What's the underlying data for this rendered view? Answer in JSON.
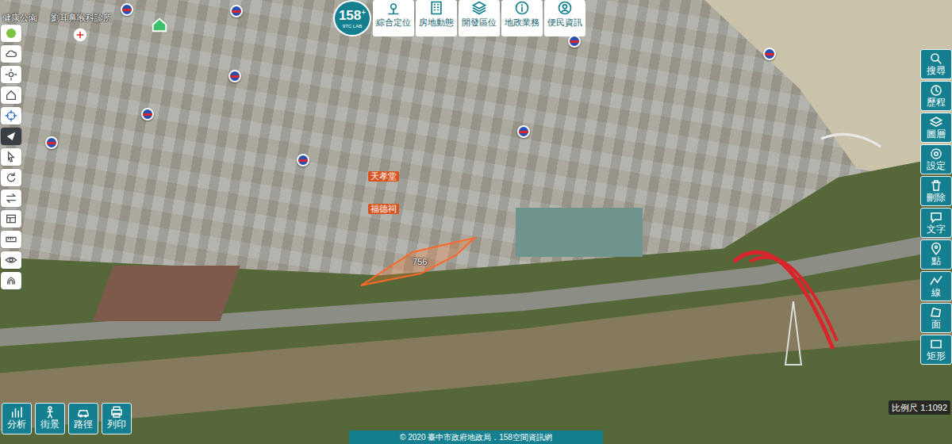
{
  "logo": {
    "number": "158",
    "mark": "+",
    "subtitle": "9TC LAB"
  },
  "top_menu": [
    "綜合定位",
    "房地動態",
    "開發區位",
    "地政業務",
    "便民資訊"
  ],
  "right_tools": [
    "搜尋",
    "歷程",
    "圖層",
    "設定",
    "刪除",
    "文字",
    "點",
    "線",
    "面",
    "矩形"
  ],
  "bottom_tools": [
    "分析",
    "街景",
    "路徑",
    "列印"
  ],
  "map_labels": [
    {
      "text": "健康公園",
      "kind": "poi"
    },
    {
      "text": "劉耳鼻喉科診所",
      "kind": "poi"
    },
    {
      "text": "天孝堂",
      "kind": "temple"
    },
    {
      "text": "福德祠",
      "kind": "temple"
    },
    {
      "text": "756",
      "kind": "parcel"
    }
  ],
  "scale": "比例尺 1:1092",
  "footer": "© 2020 臺中市政府地政局．158空間資訊網"
}
